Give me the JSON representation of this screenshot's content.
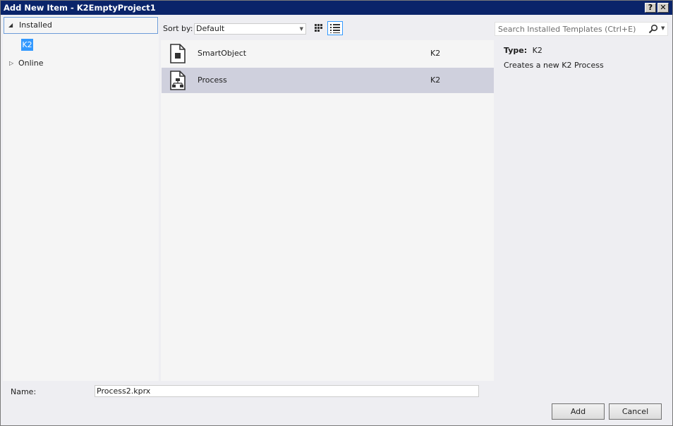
{
  "window": {
    "title": "Add New Item - K2EmptyProject1",
    "help_glyph": "?",
    "close_glyph": "✕"
  },
  "tree": {
    "installed": "Installed",
    "k2": "K2",
    "online": "Online"
  },
  "toolbar": {
    "sort_label": "Sort by:",
    "sort_value": "Default"
  },
  "search": {
    "placeholder": "Search Installed Templates (Ctrl+E)"
  },
  "items": [
    {
      "name": "SmartObject",
      "category": "K2",
      "icon": "smartobject-file-icon"
    },
    {
      "name": "Process",
      "category": "K2",
      "icon": "process-file-icon",
      "selected": true
    }
  ],
  "details": {
    "type_key": "Type:",
    "type_value": "K2",
    "description": "Creates a new K2 Process"
  },
  "footer": {
    "name_label": "Name:",
    "name_value": "Process2.kprx",
    "add_label": "Add",
    "cancel_label": "Cancel"
  },
  "colors": {
    "title_bar": "#0a246a",
    "selection": "#cfd0dd",
    "accent": "#3399ff"
  }
}
